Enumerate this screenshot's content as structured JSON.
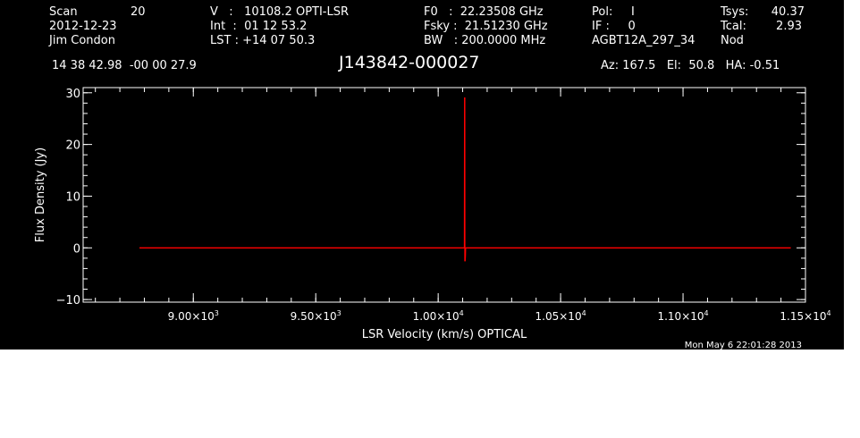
{
  "header": {
    "scan_label": "Scan",
    "scan_number": "20",
    "date": "2012-12-23",
    "observer": "Jim Condon",
    "velocity": "V   :   10108.2 OPTI-LSR",
    "integration": "Int  :  01 12 53.2",
    "lst": "LST : +14 07 50.3",
    "f0": "F0   :  22.23508 GHz",
    "fsky": "Fsky :  21.51230 GHz",
    "bw": "BW   : 200.0000 MHz",
    "pol": "Pol:     I",
    "if": "IF :     0",
    "project": "AGBT12A_297_34",
    "tsys_label": "Tsys:",
    "tsys_value": "40.37",
    "tcal_label": "Tcal:",
    "tcal_value": "2.93",
    "mode": "Nod",
    "coordinates": "14 38 42.98  -00 00 27.9",
    "source": "J143842-000027",
    "pointing": "Az: 167.5   El:  50.8   HA: -0.51"
  },
  "footer": {
    "timestamp": "Mon May  6 22:01:28 2013"
  },
  "chart_data": {
    "type": "line",
    "xlabel": "LSR Velocity (km/s) OPTICAL",
    "ylabel": "Flux Density (Jy)",
    "xlim": [
      8550,
      11500
    ],
    "ylim": [
      -10.5,
      31
    ],
    "x_ticks": [
      {
        "value": 9000,
        "mant": "9.00",
        "exp": "3"
      },
      {
        "value": 9500,
        "mant": "9.50",
        "exp": "3"
      },
      {
        "value": 10000,
        "mant": "1.00",
        "exp": "4"
      },
      {
        "value": 10500,
        "mant": "1.05",
        "exp": "4"
      },
      {
        "value": 11000,
        "mant": "1.10",
        "exp": "4"
      },
      {
        "value": 11500,
        "mant": "1.15",
        "exp": "4"
      }
    ],
    "x_minor_step": 100,
    "y_ticks": [
      -10,
      0,
      10,
      20,
      30
    ],
    "y_minor_step": 2,
    "grid": false,
    "line_color": "#ff0000",
    "axis_color": "#ffffff",
    "series": [
      {
        "x": [
          8780,
          10100,
          10106,
          10107,
          10108,
          10108.5,
          10109,
          10110,
          10111,
          10112,
          10116,
          11440
        ],
        "y": [
          0,
          0,
          0,
          0.1,
          29,
          29,
          -2.5,
          -2.5,
          -1.5,
          0,
          0,
          0
        ]
      }
    ]
  }
}
